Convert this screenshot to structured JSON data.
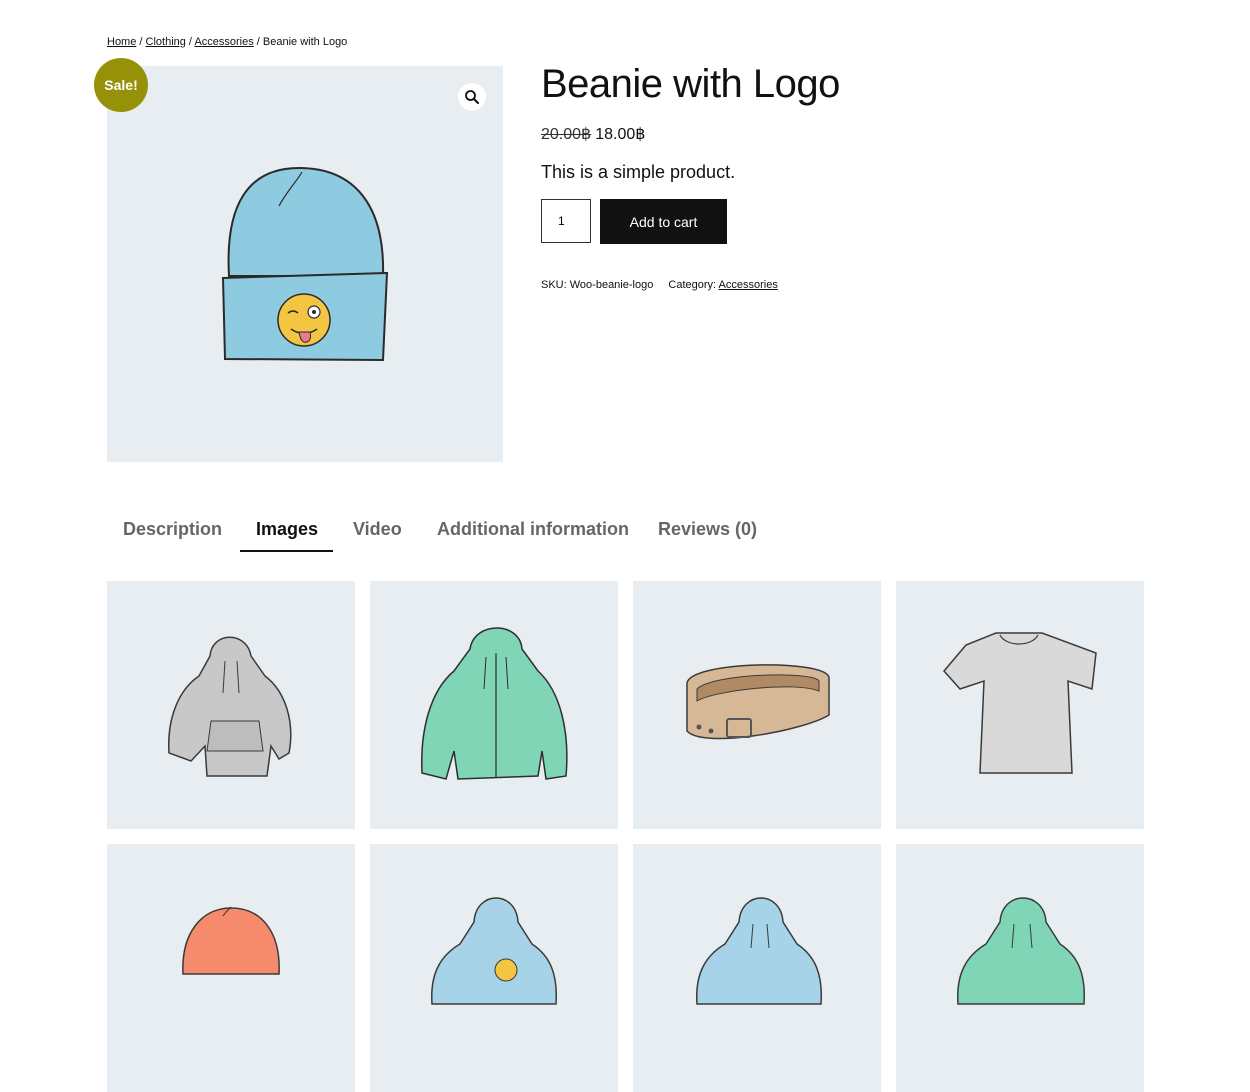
{
  "breadcrumb": {
    "home": "Home",
    "clothing": "Clothing",
    "accessories": "Accessories",
    "current": "Beanie with Logo",
    "separator": " / "
  },
  "product": {
    "sale_badge": "Sale!",
    "title": "Beanie with Logo",
    "price_old": "20.00฿",
    "price_new": "18.00฿",
    "short_description": "This is a simple product.",
    "quantity": "1",
    "add_to_cart_label": "Add to cart",
    "sku_label": "SKU:",
    "sku": "Woo-beanie-logo",
    "category_label": "Category:",
    "category": "Accessories"
  },
  "tabs": [
    {
      "label": "Description",
      "active": false
    },
    {
      "label": "Images",
      "active": true
    },
    {
      "label": "Video",
      "active": false
    },
    {
      "label": "Additional information",
      "active": false
    },
    {
      "label": "Reviews (0)",
      "active": false
    }
  ],
  "gallery_images": [
    {
      "icon": "gray-hoodie-image"
    },
    {
      "icon": "green-zip-hoodie-image"
    },
    {
      "icon": "belt-image"
    },
    {
      "icon": "gray-tshirt-image"
    },
    {
      "icon": "orange-beanie-image"
    },
    {
      "icon": "blue-hoodie-logo-image"
    },
    {
      "icon": "blue-hoodie-image"
    },
    {
      "icon": "green-hoodie-image"
    }
  ],
  "colors": {
    "sale_badge": "#959209",
    "image_background": "#e7edf0",
    "button": "#111111"
  }
}
